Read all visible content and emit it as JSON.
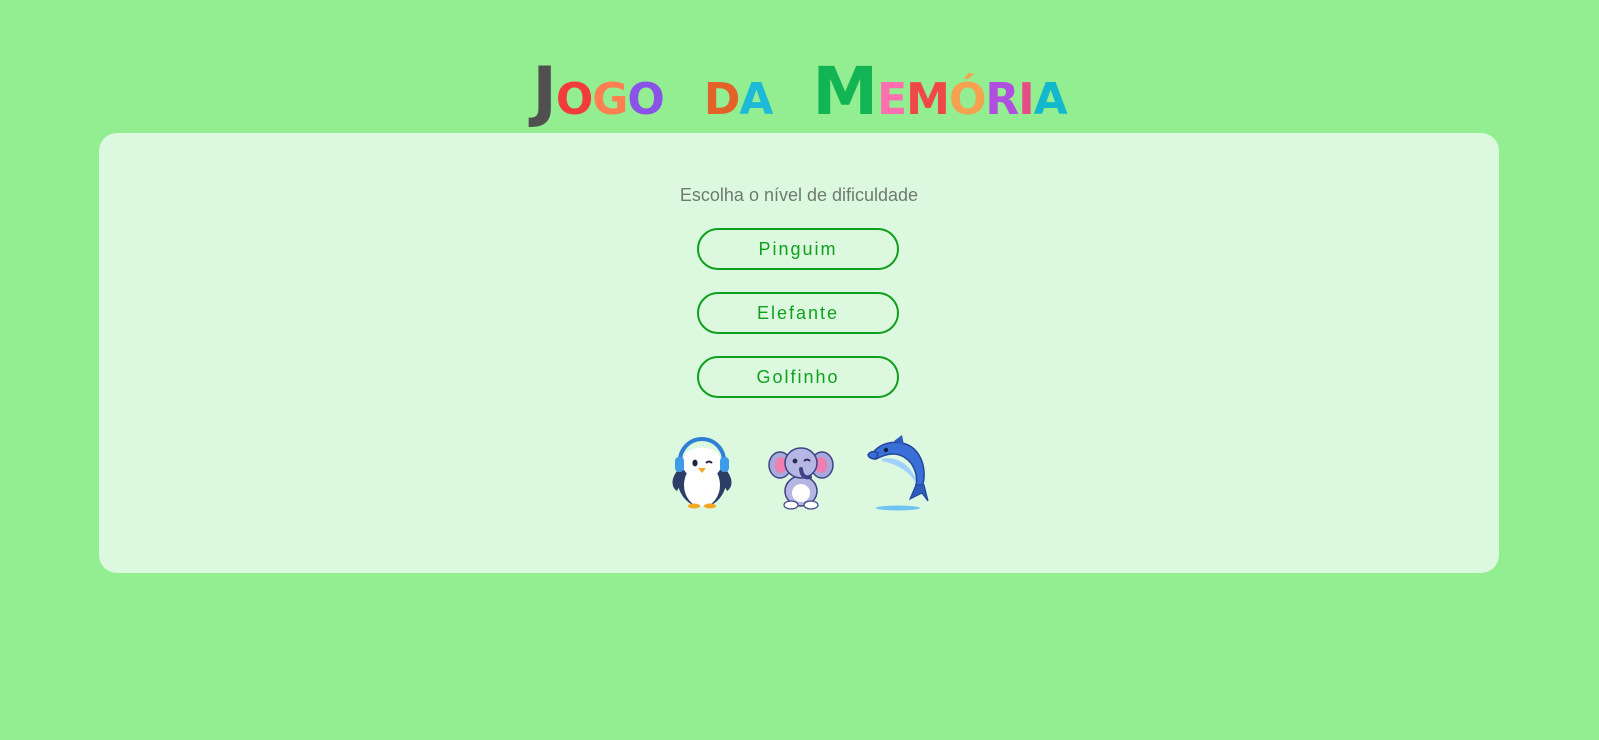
{
  "title": {
    "words": [
      {
        "letters": [
          {
            "ch": "J",
            "color": "#505050",
            "size": "big"
          },
          {
            "ch": "O",
            "color": "#f23b3b",
            "size": "sm"
          },
          {
            "ch": "G",
            "color": "#ff7f50",
            "size": "sm"
          },
          {
            "ch": "O",
            "color": "#8a52e6",
            "size": "sm"
          }
        ]
      },
      {
        "letters": [
          {
            "ch": "D",
            "color": "#e2622a",
            "size": "sm"
          },
          {
            "ch": "A",
            "color": "#1cbad6",
            "size": "sm"
          }
        ]
      },
      {
        "letters": [
          {
            "ch": "M",
            "color": "#12b454",
            "size": "big"
          },
          {
            "ch": "E",
            "color": "#ff6fb0",
            "size": "sm"
          },
          {
            "ch": "M",
            "color": "#f04848",
            "size": "sm"
          },
          {
            "ch": "Ó",
            "color": "#f5a14f",
            "size": "sm"
          },
          {
            "ch": "R",
            "color": "#b04ee0",
            "size": "sm"
          },
          {
            "ch": "I",
            "color": "#e84c88",
            "size": "sm"
          },
          {
            "ch": "A",
            "color": "#14b8cc",
            "size": "sm"
          }
        ]
      }
    ]
  },
  "panel": {
    "prompt": "Escolha o nível de dificuldade",
    "levels": [
      {
        "label": "Pinguim"
      },
      {
        "label": "Elefante"
      },
      {
        "label": "Golfinho"
      }
    ],
    "animals": [
      {
        "name": "penguin",
        "icon": "penguin-icon"
      },
      {
        "name": "elephant",
        "icon": "elephant-icon"
      },
      {
        "name": "dolphin",
        "icon": "dolphin-icon"
      }
    ]
  },
  "colors": {
    "background": "#93ee91",
    "panel": "#dcf9df",
    "accent": "#10a01e",
    "prompt_text": "#6f7a70"
  }
}
